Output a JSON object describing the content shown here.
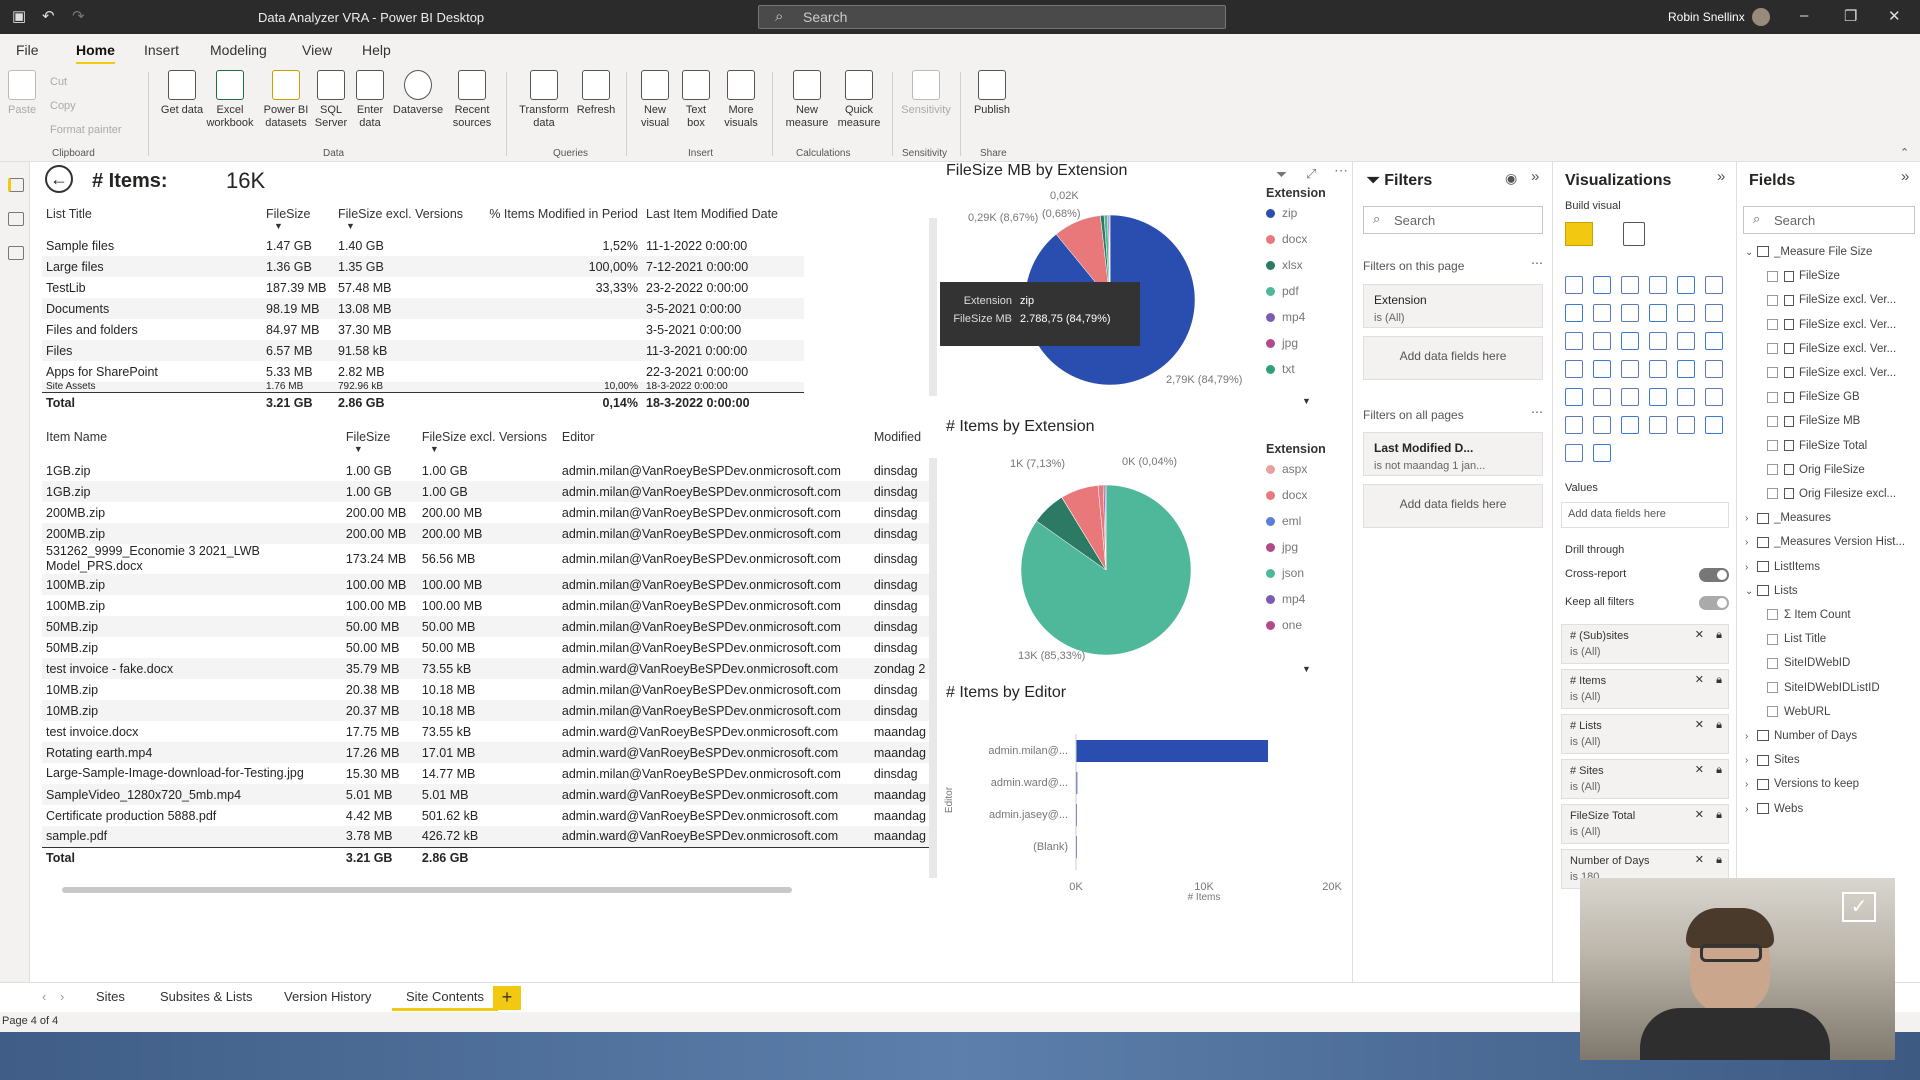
{
  "app": {
    "title": "Data Analyzer VRA - Power BI Desktop",
    "search_placeholder": "Search",
    "user": "Robin Snellinx"
  },
  "menu": [
    "File",
    "Home",
    "Insert",
    "Modeling",
    "View",
    "Help"
  ],
  "ribbon": {
    "clipboard": {
      "paste": "Paste",
      "cut": "Cut",
      "copy": "Copy",
      "format_painter": "Format painter",
      "group": "Clipboard"
    },
    "data": {
      "get_data": "Get data",
      "excel": "Excel workbook",
      "pbi_datasets": "Power BI datasets",
      "sql": "SQL Server",
      "enter_data": "Enter data",
      "dataverse": "Dataverse",
      "recent": "Recent sources",
      "group": "Data"
    },
    "queries": {
      "transform": "Transform data",
      "refresh": "Refresh",
      "group": "Queries"
    },
    "insert": {
      "new_visual": "New visual",
      "text_box": "Text box",
      "more_visuals": "More visuals",
      "group": "Insert"
    },
    "calculations": {
      "new_measure": "New measure",
      "quick_measure": "Quick measure",
      "group": "Calculations"
    },
    "sensitivity": {
      "label": "Sensitivity",
      "group": "Sensitivity"
    },
    "share": {
      "publish": "Publish",
      "group": "Share"
    }
  },
  "kpi": {
    "label": "# Items:",
    "value": "16K"
  },
  "list_table": {
    "headers": [
      "List Title",
      "FileSize",
      "FileSize excl. Versions",
      "% Items Modified in Period",
      "Last Item Modified Date"
    ],
    "rows": [
      [
        "Sample files",
        "1.47 GB",
        "1.40 GB",
        "1,52%",
        "11-1-2022 0:00:00"
      ],
      [
        "Large files",
        "1.36 GB",
        "1.35 GB",
        "100,00%",
        "7-12-2021 0:00:00"
      ],
      [
        "TestLib",
        "187.39 MB",
        "57.48 MB",
        "33,33%",
        "23-2-2022 0:00:00"
      ],
      [
        "Documents",
        "98.19 MB",
        "13.08 MB",
        "",
        "3-5-2021 0:00:00"
      ],
      [
        "Files and folders",
        "84.97 MB",
        "37.30 MB",
        "",
        "3-5-2021 0:00:00"
      ],
      [
        "Files",
        "6.57 MB",
        "91.58 kB",
        "",
        "11-3-2021 0:00:00"
      ],
      [
        "Apps for SharePoint",
        "5.33 MB",
        "2.82 MB",
        "",
        "22-3-2021 0:00:00"
      ],
      [
        "Site Assets",
        "1.76 MB",
        "792.96 kB",
        "10,00%",
        "18-3-2022 0:00:00"
      ]
    ],
    "total": [
      "Total",
      "3.21 GB",
      "2.86 GB",
      "0,14%",
      "18-3-2022 0:00:00"
    ]
  },
  "item_table": {
    "headers": [
      "Item Name",
      "FileSize",
      "FileSize excl. Versions",
      "Editor",
      "Modified"
    ],
    "rows": [
      [
        "1GB.zip",
        "1.00 GB",
        "1.00 GB",
        "admin.milan@VanRoeyBeSPDev.onmicrosoft.com",
        "dinsdag"
      ],
      [
        "1GB.zip",
        "1.00 GB",
        "1.00 GB",
        "admin.milan@VanRoeyBeSPDev.onmicrosoft.com",
        "dinsdag"
      ],
      [
        "200MB.zip",
        "200.00 MB",
        "200.00 MB",
        "admin.milan@VanRoeyBeSPDev.onmicrosoft.com",
        "dinsdag"
      ],
      [
        "200MB.zip",
        "200.00 MB",
        "200.00 MB",
        "admin.milan@VanRoeyBeSPDev.onmicrosoft.com",
        "dinsdag"
      ],
      [
        "531262_9999_Economie 3 2021_LWB Model_PRS.docx",
        "173.24 MB",
        "56.56 MB",
        "admin.milan@VanRoeyBeSPDev.onmicrosoft.com",
        "dinsdag"
      ],
      [
        "100MB.zip",
        "100.00 MB",
        "100.00 MB",
        "admin.milan@VanRoeyBeSPDev.onmicrosoft.com",
        "dinsdag"
      ],
      [
        "100MB.zip",
        "100.00 MB",
        "100.00 MB",
        "admin.milan@VanRoeyBeSPDev.onmicrosoft.com",
        "dinsdag"
      ],
      [
        "50MB.zip",
        "50.00 MB",
        "50.00 MB",
        "admin.milan@VanRoeyBeSPDev.onmicrosoft.com",
        "dinsdag"
      ],
      [
        "50MB.zip",
        "50.00 MB",
        "50.00 MB",
        "admin.milan@VanRoeyBeSPDev.onmicrosoft.com",
        "dinsdag"
      ],
      [
        "test invoice - fake.docx",
        "35.79 MB",
        "73.55 kB",
        "admin.ward@VanRoeyBeSPDev.onmicrosoft.com",
        "zondag 2"
      ],
      [
        "10MB.zip",
        "20.38 MB",
        "10.18 MB",
        "admin.milan@VanRoeyBeSPDev.onmicrosoft.com",
        "dinsdag"
      ],
      [
        "10MB.zip",
        "20.37 MB",
        "10.18 MB",
        "admin.milan@VanRoeyBeSPDev.onmicrosoft.com",
        "dinsdag"
      ],
      [
        "test invoice.docx",
        "17.75 MB",
        "73.55 kB",
        "admin.ward@VanRoeyBeSPDev.onmicrosoft.com",
        "maandag"
      ],
      [
        "Rotating earth.mp4",
        "17.26 MB",
        "17.01 MB",
        "admin.ward@VanRoeyBeSPDev.onmicrosoft.com",
        "maandag"
      ],
      [
        "Large-Sample-Image-download-for-Testing.jpg",
        "15.30 MB",
        "14.77 MB",
        "admin.milan@VanRoeyBeSPDev.onmicrosoft.com",
        "dinsdag"
      ],
      [
        "SampleVideo_1280x720_5mb.mp4",
        "5.01 MB",
        "5.01 MB",
        "admin.ward@VanRoeyBeSPDev.onmicrosoft.com",
        "maandag"
      ],
      [
        "Certificate production 5888.pdf",
        "4.42 MB",
        "501.62 kB",
        "admin.ward@VanRoeyBeSPDev.onmicrosoft.com",
        "maandag"
      ],
      [
        "sample.pdf",
        "3.78 MB",
        "426.72 kB",
        "admin.ward@VanRoeyBeSPDev.onmicrosoft.com",
        "maandag"
      ]
    ],
    "total": [
      "Total",
      "3.21 GB",
      "2.86 GB"
    ]
  },
  "chart1": {
    "title": "FileSize MB by Extension",
    "legend_title": "Extension",
    "legend": [
      "zip",
      "docx",
      "xlsx",
      "pdf",
      "mp4",
      "jpg",
      "txt"
    ],
    "labels": {
      "top": "0,02K",
      "left": "0,29K (8,67%)",
      "small": "(0,68%)",
      "bottom": "2,79K (84,79%)"
    },
    "tooltip": {
      "k1": "Extension",
      "v1": "zip",
      "k2": "FileSize MB",
      "v2": "2.788,75 (84,79%)"
    }
  },
  "chart2": {
    "title": "# Items by Extension",
    "legend_title": "Extension",
    "legend": [
      "aspx",
      "docx",
      "eml",
      "jpg",
      "json",
      "mp4",
      "one"
    ],
    "labels": {
      "left": "1K (7,13%)",
      "right": "0K (0,04%)",
      "bottom": "13K (85,33%)"
    }
  },
  "chart3": {
    "title": "# Items by Editor",
    "ylabel": "Editor",
    "xlabel": "# Items",
    "ticks": [
      "0K",
      "10K",
      "20K"
    ]
  },
  "chart_data": [
    {
      "type": "pie",
      "title": "FileSize MB by Extension",
      "categories": [
        "zip",
        "docx",
        "xlsx",
        "pdf",
        "mp4",
        "jpg",
        "txt"
      ],
      "values": [
        2788.75,
        285,
        22,
        20,
        8,
        5,
        2
      ],
      "labels": [
        "2,79K (84,79%)",
        "0,29K (8,67%)",
        "0,02K",
        "(0,68%)"
      ]
    },
    {
      "type": "pie",
      "title": "# Items by Extension",
      "categories": [
        "aspx",
        "docx",
        "eml",
        "jpg",
        "json",
        "mp4",
        "one"
      ],
      "values": [
        13000,
        1000,
        6,
        1100,
        150,
        50,
        30
      ],
      "labels": [
        "13K (85,33%)",
        "1K (7,13%)",
        "0K (0,04%)"
      ]
    },
    {
      "type": "bar",
      "title": "# Items by Editor",
      "categories": [
        "admin.milan@...",
        "admin.ward@...",
        "admin.jasey@...",
        "(Blank)"
      ],
      "values": [
        15000,
        100,
        50,
        10
      ],
      "xlim": [
        0,
        20000
      ],
      "xlabel": "# Items",
      "ylabel": "Editor"
    }
  ],
  "filters": {
    "title": "Filters",
    "search": "Search",
    "on_page": "Filters on this page",
    "card1": {
      "name": "Extension",
      "value": "is (All)"
    },
    "add": "Add data fields here",
    "all_pages": "Filters on all pages",
    "card2": {
      "name": "Last Modified D...",
      "value": "is not maandag 1 jan..."
    }
  },
  "viz": {
    "title": "Visualizations",
    "build": "Build visual",
    "values": "Values",
    "add": "Add data fields here",
    "drill": "Drill through",
    "cross": "Cross-report",
    "keep": "Keep all filters",
    "wells": [
      {
        "name": "# (Sub)sites",
        "value": "is (All)"
      },
      {
        "name": "# Items",
        "value": "is (All)"
      },
      {
        "name": "# Lists",
        "value": "is (All)"
      },
      {
        "name": "# Sites",
        "value": "is (All)"
      },
      {
        "name": "FileSize Total",
        "value": "is (All)"
      },
      {
        "name": "Number of Days",
        "value": "is 180"
      }
    ]
  },
  "fields": {
    "title": "Fields",
    "search": "Search",
    "items": [
      {
        "t": "_Measure File Size",
        "k": "table"
      },
      {
        "t": "FileSize",
        "k": "field"
      },
      {
        "t": "FileSize excl. Ver...",
        "k": "field"
      },
      {
        "t": "FileSize excl. Ver...",
        "k": "field"
      },
      {
        "t": "FileSize excl. Ver...",
        "k": "field"
      },
      {
        "t": "FileSize excl. Ver...",
        "k": "field"
      },
      {
        "t": "FileSize GB",
        "k": "field"
      },
      {
        "t": "FileSize MB",
        "k": "field"
      },
      {
        "t": "FileSize Total",
        "k": "field"
      },
      {
        "t": "Orig FileSize",
        "k": "field"
      },
      {
        "t": "Orig Filesize excl...",
        "k": "field"
      },
      {
        "t": "_Measures",
        "k": "table"
      },
      {
        "t": "_Measures Version Hist...",
        "k": "table"
      },
      {
        "t": "ListItems",
        "k": "table"
      },
      {
        "t": "Lists",
        "k": "table"
      },
      {
        "t": "Item Count",
        "k": "sigma"
      },
      {
        "t": "List Title",
        "k": "plain"
      },
      {
        "t": "SiteIDWebID",
        "k": "plain"
      },
      {
        "t": "SiteIDWebIDListID",
        "k": "plain"
      },
      {
        "t": "WebURL",
        "k": "plain"
      },
      {
        "t": "Number of Days",
        "k": "table"
      },
      {
        "t": "Sites",
        "k": "table"
      },
      {
        "t": "Versions to keep",
        "k": "table"
      },
      {
        "t": "Webs",
        "k": "table"
      }
    ]
  },
  "tabs": [
    "Sites",
    "Subsites & Lists",
    "Version History",
    "Site Contents"
  ],
  "status": "Page 4 of 4",
  "colors": {
    "accent": "#f2c811",
    "zip": "#2a4db0",
    "docx": "#e8787a",
    "teal": "#4fb89a",
    "dark_teal": "#2c7a63"
  }
}
